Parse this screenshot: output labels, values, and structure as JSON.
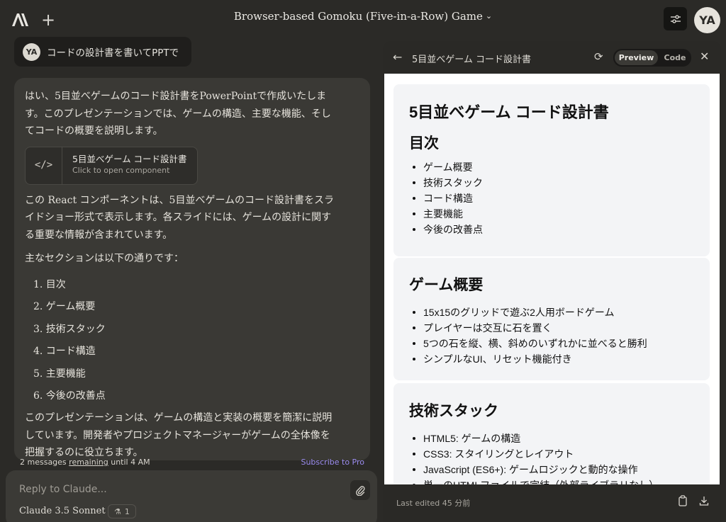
{
  "header": {
    "title": "Browser-based Gomoku (Five-in-a-Row) Game",
    "avatar": "YA",
    "icons": {
      "logo": "anthropic-logo",
      "new": "plus-icon",
      "settings": "sliders-icon",
      "dropdown": "chevron-down-icon"
    }
  },
  "user_message": {
    "avatar": "YA",
    "text": "コードの設計書を書いてPPTで"
  },
  "assistant": {
    "intro": "はい、5目並べゲームのコード設計書をPowerPointで作成いたします。このプレゼンテーションでは、ゲームの構造、主要な機能、そしてコードの概要を説明します。",
    "artifact": {
      "title": "5目並べゲーム コード設計書",
      "subtitle": "Click to open component",
      "icon": "code-icon"
    },
    "para2": "この React コンポーネントは、5目並べゲームのコード設計書をスライドショー形式で表示します。各スライドには、ゲームの設計に関する重要な情報が含まれています。",
    "para3": "主なセクションは以下の通りです：",
    "sections": [
      "1. 目次",
      "2. ゲーム概要",
      "3. 技術スタック",
      "4. コード構造",
      "5. 主要機能",
      "6. 今後の改善点"
    ],
    "para4": "このプレゼンテーションは、ゲームの構造と実装の概要を簡潔に説明しています。開発者やプロジェクトマネージャーがゲームの全体像を把握するのに役立ちます。"
  },
  "limit": {
    "count": "2 messages",
    "remaining": "remaining",
    "until": "until 4 AM",
    "subscribe": "Subscribe to Pro"
  },
  "composer": {
    "placeholder": "Reply to Claude...",
    "model": "Claude 3.5 Sonnet",
    "badge_count": "1",
    "icons": {
      "attach": "paperclip-icon",
      "badge": "flask-icon"
    }
  },
  "panel": {
    "title": "5目並べゲーム コード設計書",
    "preview_label": "Preview",
    "code_label": "Code",
    "last_edited": "Last edited 45 分前",
    "icons": {
      "back": "arrow-left-icon",
      "refresh": "refresh-icon",
      "close": "close-icon",
      "copy": "copy-icon",
      "download": "download-icon"
    },
    "slides": [
      {
        "title": "5目並べゲーム コード設計書",
        "subtitle": "目次",
        "items": [
          "ゲーム概要",
          "技術スタック",
          "コード構造",
          "主要機能",
          "今後の改善点"
        ]
      },
      {
        "title": "ゲーム概要",
        "items": [
          "15x15のグリッドで遊ぶ2人用ボードゲーム",
          "プレイヤーは交互に石を置く",
          "5つの石を縦、横、斜めのいずれかに並べると勝利",
          "シンプルなUI、リセット機能付き"
        ]
      },
      {
        "title": "技術スタック",
        "items": [
          "HTML5: ゲームの構造",
          "CSS3: スタイリングとレイアウト",
          "JavaScript (ES6+): ゲームロジックと動的な操作",
          "単一のHTMLファイルで完結（外部ライブラリなし）"
        ]
      }
    ]
  }
}
